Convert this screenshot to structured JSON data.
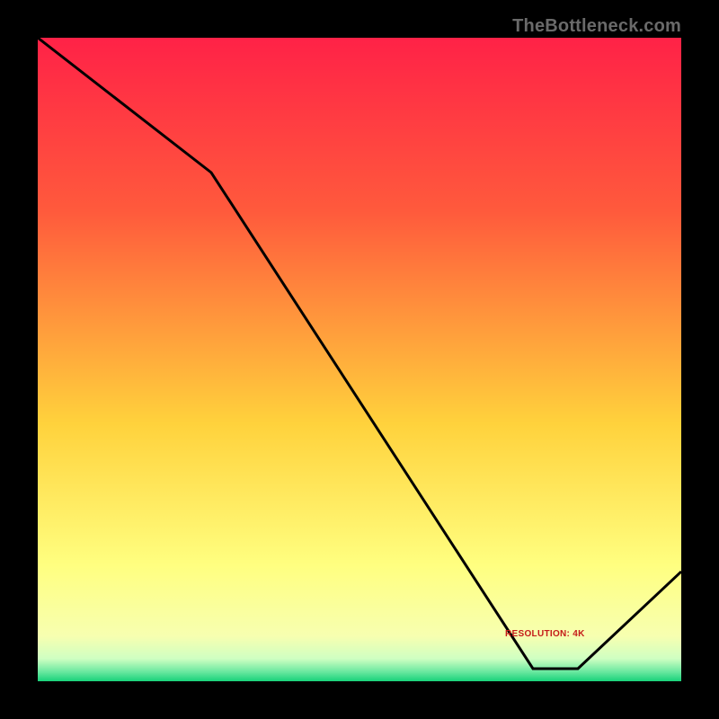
{
  "source_label": "TheBottleneck.com",
  "chart_data": {
    "type": "line",
    "title": "",
    "xlabel": "",
    "ylabel": "",
    "xlim": [
      0,
      100
    ],
    "ylim": [
      0,
      100
    ],
    "x": [
      0,
      27,
      77,
      84,
      100
    ],
    "values": [
      100,
      79,
      2,
      2,
      17
    ],
    "gradient_bands": [
      {
        "stop": 0.0,
        "color": "#ff2247"
      },
      {
        "stop": 0.27,
        "color": "#ff5a3c"
      },
      {
        "stop": 0.6,
        "color": "#ffd23c"
      },
      {
        "stop": 0.82,
        "color": "#ffff80"
      },
      {
        "stop": 0.93,
        "color": "#f7ffb0"
      },
      {
        "stop": 0.965,
        "color": "#cfffc2"
      },
      {
        "stop": 0.985,
        "color": "#6be8a0"
      },
      {
        "stop": 1.0,
        "color": "#18d27a"
      }
    ],
    "annotation": {
      "text": "RESOLUTION: 4K"
    }
  }
}
